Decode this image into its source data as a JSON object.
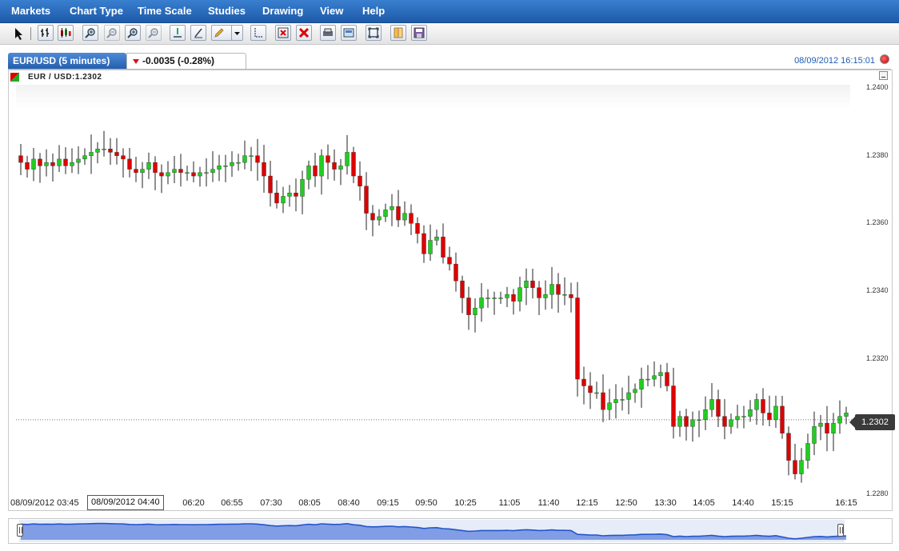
{
  "menu": [
    "Markets",
    "Chart Type",
    "Time Scale",
    "Studies",
    "Drawing",
    "View",
    "Help"
  ],
  "toolbar": {
    "icons": [
      "pointer-icon",
      "crosshair-icon",
      "bar-chart-icon",
      "candlestick-icon",
      "zoom-in-icon",
      "zoom-out-icon",
      "zoom-in-alt-icon",
      "zoom-out-alt-icon",
      "cursor-line-icon",
      "trend-line-icon",
      "pencil-icon",
      "dropdown-arrow-icon",
      "measure-icon",
      "delete-drawing-icon",
      "delete-all-icon",
      "print-icon",
      "screenshot-icon",
      "fullscreen-icon",
      "load-icon",
      "save-icon"
    ]
  },
  "tab": {
    "label": "EUR/USD (5 minutes)",
    "change": "-0.0035 (-0.28%)"
  },
  "timestamp": "08/09/2012 16:15:01",
  "symbol_label": "EUR / USD:1.2302",
  "current_price": "1.2302",
  "hover_label": "08/09/2012 04:40",
  "first_x_label": "08/09/2012 03:45",
  "colors": {
    "up": "#22cc22",
    "down": "#dd0000",
    "accent": "#1f5db0",
    "navigator": "#2456c8"
  },
  "chart_data": {
    "type": "candlestick",
    "title": "",
    "xlabel": "",
    "ylabel": "",
    "ylim": [
      1.228,
      1.24
    ],
    "yticks": [
      "1.2400",
      "1.2380",
      "1.2360",
      "1.2340",
      "1.2320",
      "1.2280"
    ],
    "xticks": [
      "06:20",
      "06:55",
      "07:30",
      "08:05",
      "08:40",
      "09:15",
      "09:50",
      "10:25",
      "11:05",
      "11:40",
      "12:15",
      "12:50",
      "13:30",
      "14:05",
      "14:40",
      "15:15",
      "16:15"
    ],
    "grid": false,
    "legend": "none",
    "last_price": 1.2302,
    "closes": [
      1.2378,
      1.2376,
      1.2379,
      1.2377,
      1.2378,
      1.2377,
      1.2379,
      1.2377,
      1.2378,
      1.2379,
      1.238,
      1.2381,
      1.2382,
      1.2382,
      1.2381,
      1.238,
      1.2379,
      1.2376,
      1.2375,
      1.2376,
      1.2378,
      1.2375,
      1.2374,
      1.2375,
      1.2376,
      1.2375,
      1.2375,
      1.2374,
      1.2375,
      1.2375,
      1.2376,
      1.2377,
      1.2377,
      1.2378,
      1.2378,
      1.238,
      1.238,
      1.2378,
      1.2374,
      1.2369,
      1.2366,
      1.2368,
      1.2369,
      1.2368,
      1.2373,
      1.2377,
      1.2374,
      1.238,
      1.2378,
      1.2376,
      1.2377,
      1.2381,
      1.2374,
      1.2371,
      1.2363,
      1.2361,
      1.2362,
      1.2364,
      1.2365,
      1.2361,
      1.2363,
      1.236,
      1.2357,
      1.2351,
      1.2355,
      1.2356,
      1.235,
      1.2348,
      1.2343,
      1.2338,
      1.2333,
      1.2335,
      1.2338,
      1.2338,
      1.2338,
      1.2338,
      1.2339,
      1.2337,
      1.2341,
      1.2343,
      1.2341,
      1.2338,
      1.2339,
      1.2342,
      1.2339,
      1.2339,
      1.2338,
      1.2314,
      1.2312,
      1.231,
      1.231,
      1.2305,
      1.2307,
      1.2308,
      1.2308,
      1.231,
      1.2311,
      1.2314,
      1.2314,
      1.2315,
      1.2316,
      1.2312,
      1.23,
      1.2303,
      1.23,
      1.2302,
      1.2302,
      1.2305,
      1.2308,
      1.2303,
      1.23,
      1.2302,
      1.2303,
      1.2303,
      1.2305,
      1.2308,
      1.2304,
      1.2302,
      1.2306,
      1.2298,
      1.229,
      1.2286,
      1.229,
      1.2295,
      1.23,
      1.2301,
      1.2298,
      1.2301,
      1.2303,
      1.2304
    ]
  }
}
